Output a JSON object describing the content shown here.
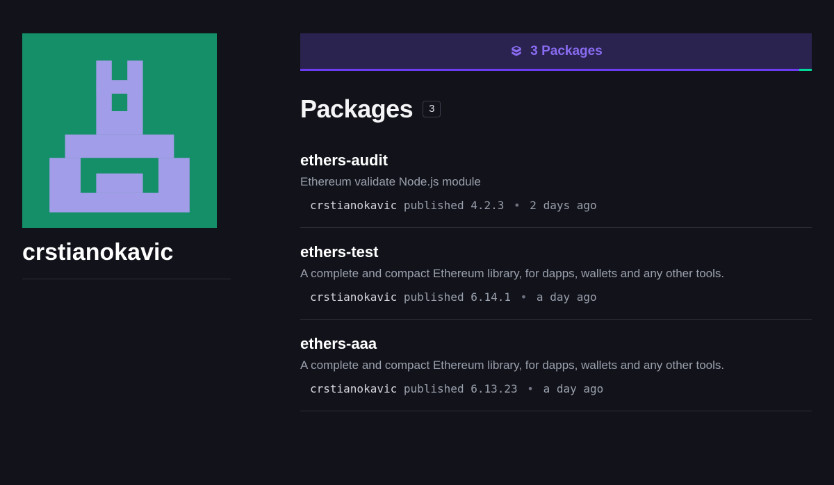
{
  "profile": {
    "username": "crstianokavic"
  },
  "tab": {
    "label": "3 Packages"
  },
  "section": {
    "title": "Packages",
    "count": "3"
  },
  "packages": [
    {
      "name": "ethers-audit",
      "description": "Ethereum validate Node.js module",
      "author": "crstianokavic",
      "published_word": "published",
      "version": "4.2.3",
      "when": "2 days ago"
    },
    {
      "name": "ethers-test",
      "description": "A complete and compact Ethereum library, for dapps, wallets and any other tools.",
      "author": "crstianokavic",
      "published_word": "published",
      "version": "6.14.1",
      "when": "a day ago"
    },
    {
      "name": "ethers-aaa",
      "description": "A complete and compact Ethereum library, for dapps, wallets and any other tools.",
      "author": "crstianokavic",
      "published_word": "published",
      "version": "6.13.23",
      "when": "a day ago"
    }
  ]
}
